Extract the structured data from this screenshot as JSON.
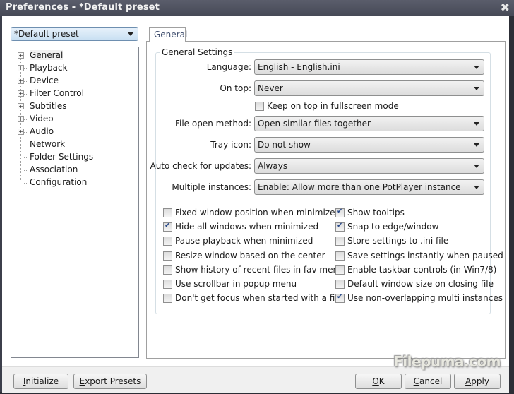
{
  "window": {
    "title": "Preferences - *Default preset",
    "close_glyph": "✖"
  },
  "preset_dropdown": {
    "value": "*Default preset"
  },
  "tree": {
    "items": [
      {
        "label": "General",
        "expandable": true,
        "expand_glyph": "+"
      },
      {
        "label": "Playback",
        "expandable": true,
        "expand_glyph": "+"
      },
      {
        "label": "Device",
        "expandable": true,
        "expand_glyph": "+"
      },
      {
        "label": "Filter Control",
        "expandable": true,
        "expand_glyph": "+"
      },
      {
        "label": "Subtitles",
        "expandable": true,
        "expand_glyph": "+"
      },
      {
        "label": "Video",
        "expandable": true,
        "expand_glyph": "+"
      },
      {
        "label": "Audio",
        "expandable": true,
        "expand_glyph": "+"
      },
      {
        "label": "Network",
        "expandable": false
      },
      {
        "label": "Folder Settings",
        "expandable": false
      },
      {
        "label": "Association",
        "expandable": false
      },
      {
        "label": "Configuration",
        "expandable": false
      }
    ]
  },
  "tab": {
    "label": "General"
  },
  "general_settings": {
    "group_title": "General Settings",
    "rows": [
      {
        "label": "Language:",
        "value": "English - English.ini"
      },
      {
        "label": "On top:",
        "value": "Never"
      },
      {
        "label": "File open method:",
        "value": "Open similar files together"
      },
      {
        "label": "Tray icon:",
        "value": "Do not show"
      },
      {
        "label": "Auto check for updates:",
        "value": "Always"
      },
      {
        "label": "Multiple instances:",
        "value": "Enable: Allow more than one PotPlayer instance"
      }
    ],
    "keep_on_top_fullscreen": {
      "label": "Keep on top in fullscreen mode",
      "checked": false
    }
  },
  "checkboxes_left": [
    {
      "label": "Fixed window position when minimized",
      "checked": false
    },
    {
      "label": "Hide all windows when minimized",
      "checked": true
    },
    {
      "label": "Pause playback when minimized",
      "checked": false
    },
    {
      "label": "Resize window based on the center",
      "checked": false
    },
    {
      "label": "Show history of recent files in fav menu",
      "checked": false
    },
    {
      "label": "Use scrollbar in popup menu",
      "checked": false
    },
    {
      "label": "Don't get focus when started with a file",
      "checked": false
    }
  ],
  "checkboxes_right": [
    {
      "label": "Show tooltips",
      "checked": true
    },
    {
      "label": "Snap to edge/window",
      "checked": true
    },
    {
      "label": "Store settings to .ini file",
      "checked": false
    },
    {
      "label": "Save settings instantly when paused",
      "checked": false
    },
    {
      "label": "Enable taskbar controls (in Win7/8)",
      "checked": false
    },
    {
      "label": "Default window size on closing file",
      "checked": false
    },
    {
      "label": "Use non-overlapping multi instances",
      "checked": true
    }
  ],
  "buttons": {
    "initialize": {
      "mnemonic": "I",
      "rest": "nitialize"
    },
    "export_presets": {
      "mnemonic": "E",
      "rest": "xport Presets"
    },
    "ok": {
      "mnemonic": "O",
      "rest": "K"
    },
    "cancel": {
      "mnemonic": "C",
      "rest": "ancel"
    },
    "apply": {
      "mnemonic": "A",
      "rest": "pply"
    }
  },
  "watermark": "Filepuma.com"
}
